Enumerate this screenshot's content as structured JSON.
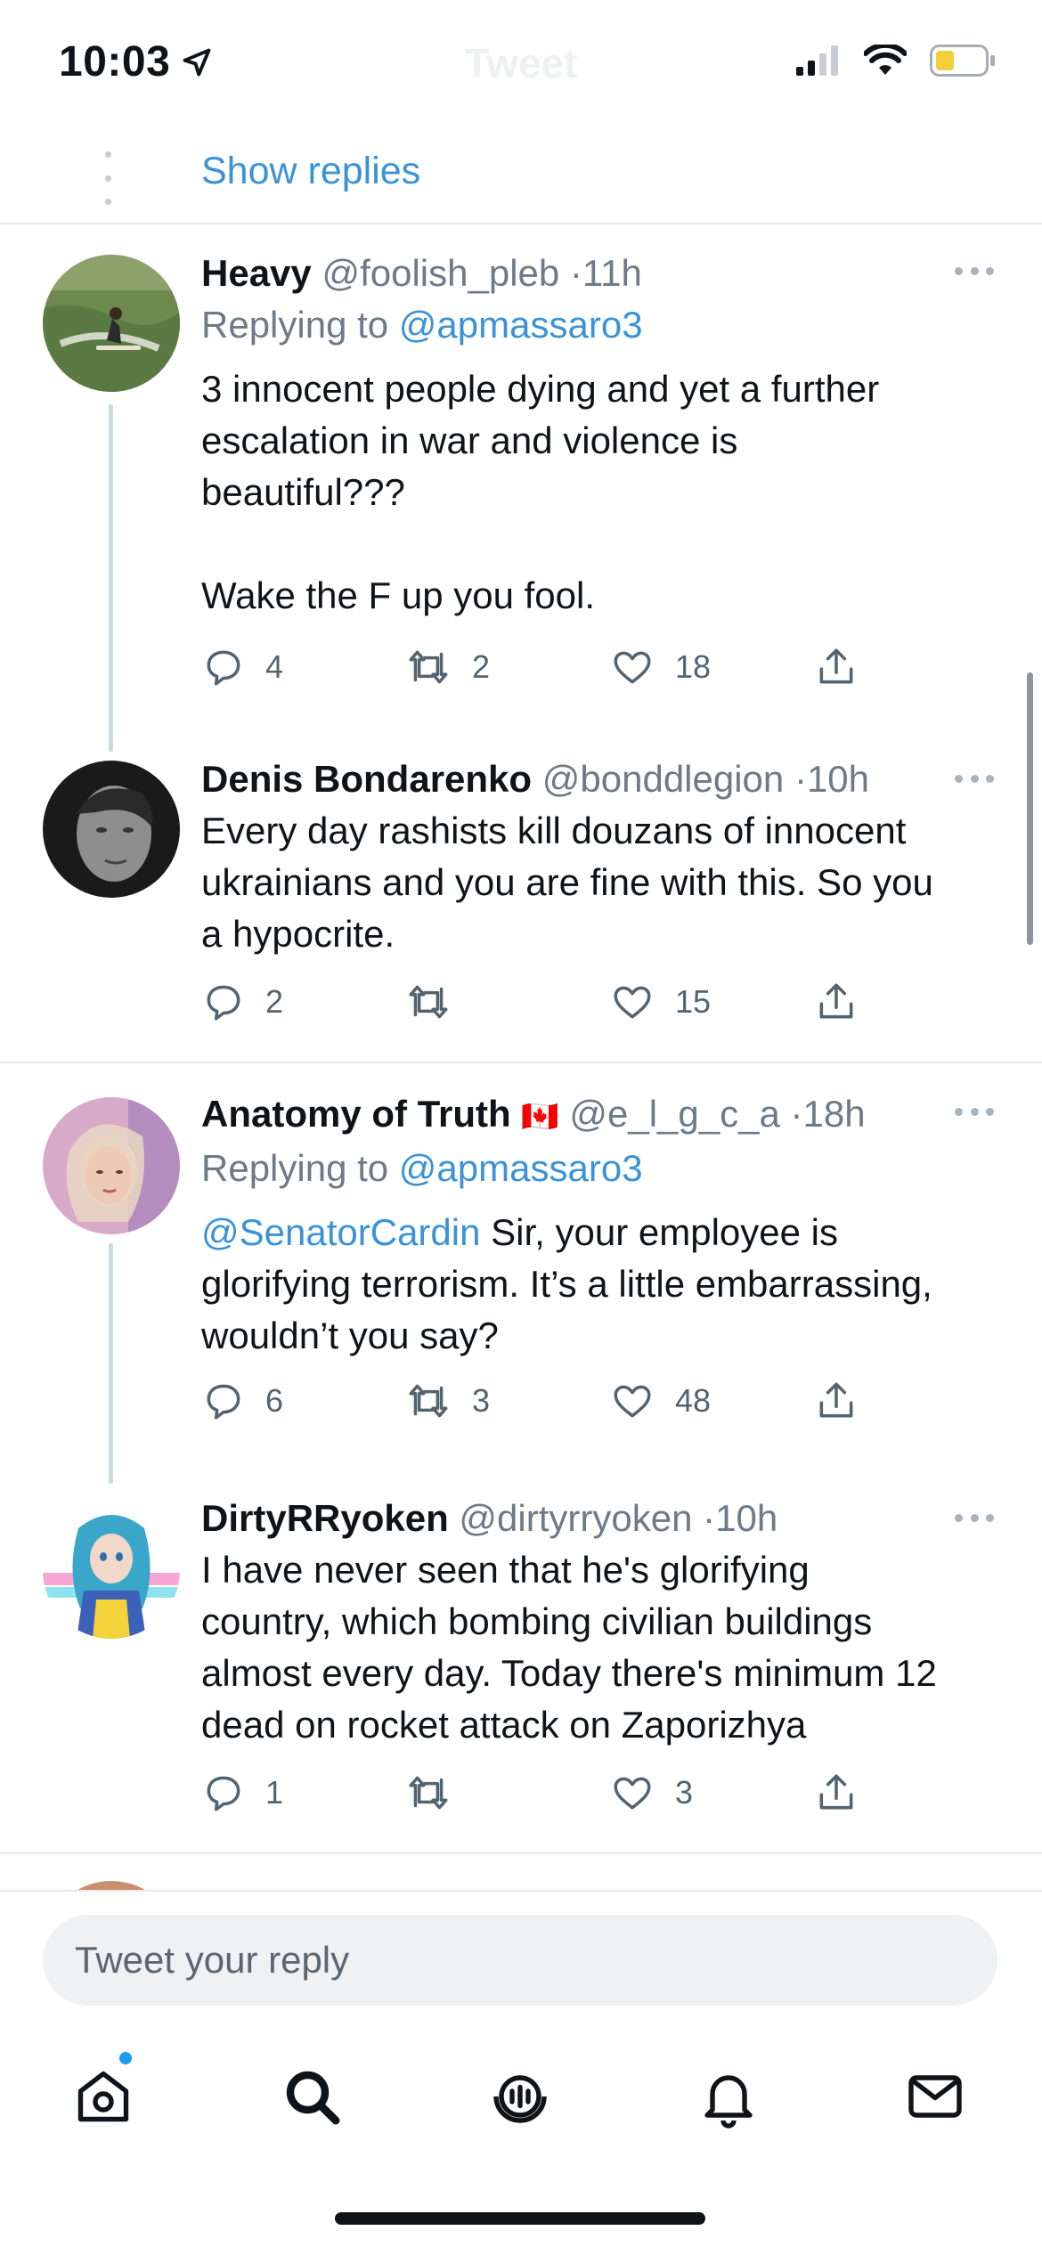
{
  "status_bar": {
    "time": "10:03",
    "ghost_title": "Tweet"
  },
  "thread_controls": {
    "show_replies_label": "Show replies"
  },
  "tweets": [
    {
      "name": "Heavy",
      "handle": "@foolish_pleb",
      "time": "11h",
      "replying_prefix": "Replying to",
      "replying_to": "@apmassaro3",
      "body_lines": [
        "3 innocent people dying and yet a further",
        "escalation in war and violence is",
        "beautiful???",
        "",
        "Wake the F up you fool."
      ],
      "replies": "4",
      "retweets": "2",
      "likes": "18"
    },
    {
      "name": "Denis Bondarenko",
      "handle": "@bonddlegion",
      "time": "10h",
      "body_lines": [
        "Every day rashists kill douzans of innocent",
        "ukrainians and you are fine with this. So you",
        "a hypocrite."
      ],
      "replies": "2",
      "retweets": "",
      "likes": "15"
    },
    {
      "name": "Anatomy of Truth",
      "flag": "🇨🇦",
      "handle": "@e_l_g_c_a",
      "time": "18h",
      "replying_prefix": "Replying to",
      "replying_to": "@apmassaro3",
      "body_mention": "@SenatorCardin",
      "body_lines": [
        " Sir, your employee is",
        "glorifying terrorism. It’s a little embarrassing,",
        "wouldn’t you say?"
      ],
      "replies": "6",
      "retweets": "3",
      "likes": "48"
    },
    {
      "name": "DirtyRRyoken",
      "handle": "@dirtyrryoken",
      "time": "10h",
      "body_lines": [
        "I have never seen that he's glorifying",
        "country, which bombing civilian buildings",
        "almost every day. Today there's minimum 12",
        "dead on rocket attack on Zaporizhya"
      ],
      "replies": "1",
      "retweets": "",
      "likes": "3"
    }
  ],
  "reply_bar": {
    "placeholder": "Tweet your reply"
  },
  "nav": {
    "items": [
      "home-icon",
      "search-icon",
      "spaces-icon",
      "notifications-icon",
      "messages-icon"
    ]
  },
  "colors": {
    "link": "#3b93d6",
    "meta": "#6e7a86",
    "divider": "#e7e9eb",
    "badge": "#1d9bf0"
  }
}
